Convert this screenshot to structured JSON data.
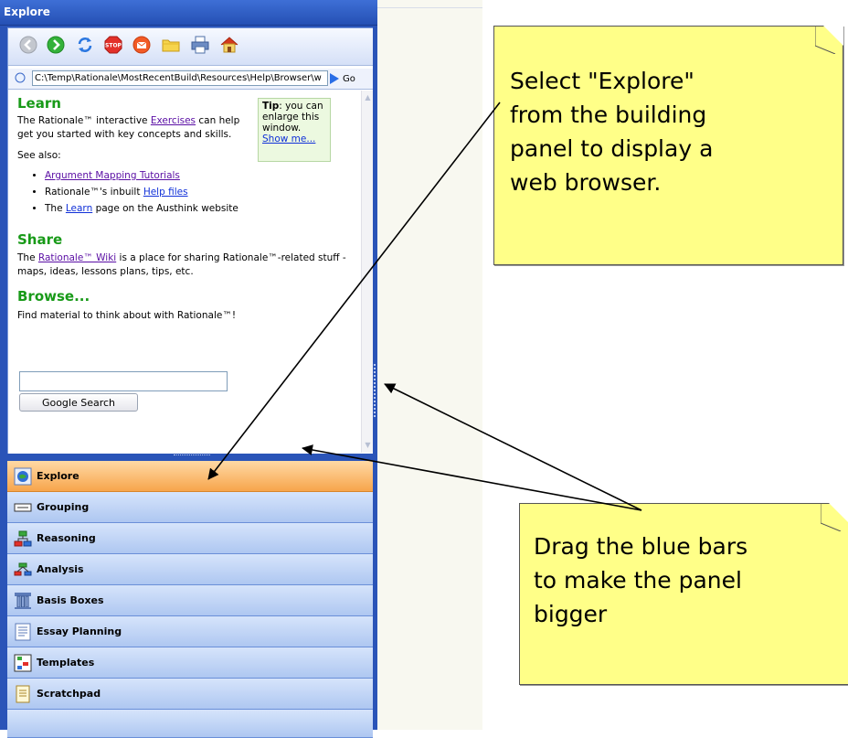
{
  "window": {
    "title": "Explore"
  },
  "toolbar": {
    "buttons": [
      "back-icon",
      "forward-icon",
      "refresh-icon",
      "stop-icon",
      "folder-icon",
      "print-icon",
      "home-icon"
    ]
  },
  "address": {
    "value": "C:\\Temp\\Rationale\\MostRecentBuild\\Resources\\Help\\Browser\\w",
    "go_label": "Go"
  },
  "page": {
    "learn": {
      "heading": "Learn",
      "intro_before": "The Rationale™ interactive ",
      "intro_link": "Exercises",
      "intro_after": " can help get you started with key concepts and skills.",
      "see_also": "See also:",
      "bullets": [
        {
          "before": "",
          "link": "Argument Mapping Tutorials",
          "after": ""
        },
        {
          "before": "Rationale™'s inbuilt ",
          "link": "Help files",
          "after": ""
        },
        {
          "before": "The ",
          "link": "Learn",
          "after": " page on the Austhink website"
        }
      ]
    },
    "tip": {
      "bold": "Tip",
      "text": ": you can enlarge this window.",
      "link": "Show me..."
    },
    "share": {
      "heading": "Share",
      "before": "The ",
      "link": "Rationale™ Wiki",
      "after": " is a place for sharing Rationale™-related stuff - maps, ideas, lessons plans, tips, etc."
    },
    "browse": {
      "heading": "Browse...",
      "text": "Find material to think about with Rationale™!",
      "search_value": "",
      "search_button": "Google Search"
    }
  },
  "nav": {
    "items": [
      {
        "label": "Explore",
        "icon": "globe-icon",
        "active": true
      },
      {
        "label": "Grouping",
        "icon": "grouping-icon",
        "active": false
      },
      {
        "label": "Reasoning",
        "icon": "reasoning-icon",
        "active": false
      },
      {
        "label": "Analysis",
        "icon": "analysis-icon",
        "active": false
      },
      {
        "label": "Basis Boxes",
        "icon": "basis-boxes-icon",
        "active": false
      },
      {
        "label": "Essay Planning",
        "icon": "essay-planning-icon",
        "active": false
      },
      {
        "label": "Templates",
        "icon": "templates-icon",
        "active": false
      },
      {
        "label": "Scratchpad",
        "icon": "scratchpad-icon",
        "active": false
      }
    ]
  },
  "callouts": {
    "top": [
      "Select \"Explore\"",
      "from the building",
      "panel to display a",
      "web browser."
    ],
    "bottom": [
      "Drag the blue bars",
      "to make the panel",
      "bigger"
    ]
  },
  "colors": {
    "panel_blue": "#2a54b8",
    "heading_green": "#189a18",
    "active_orange": "#f7a54b",
    "note_yellow": "#ffff88"
  }
}
